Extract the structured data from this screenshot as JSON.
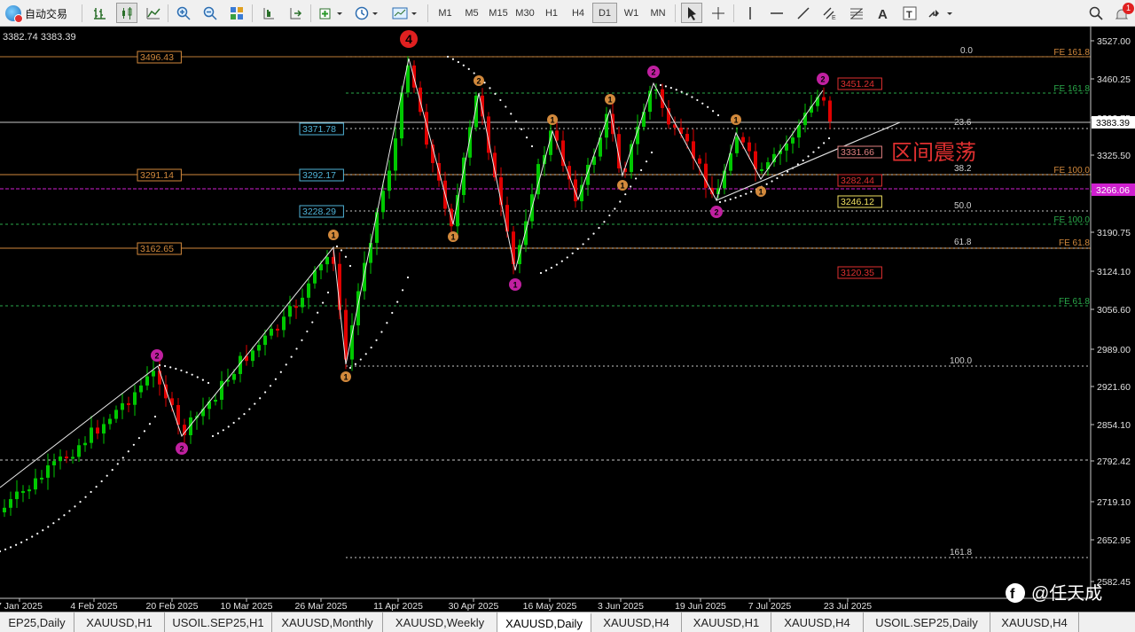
{
  "toolbar": {
    "autotrade_label": "自动交易",
    "timeframes": [
      "M1",
      "M5",
      "M15",
      "M30",
      "H1",
      "H4",
      "D1",
      "W1",
      "MN"
    ],
    "active_timeframe": "D1",
    "notification_count": "1"
  },
  "chart": {
    "quote": "3382.74 3383.39",
    "annotation": "区间震荡",
    "watermark": "@任天成",
    "current_price": "3383.39",
    "price_axis": [
      "3527.00",
      "3460.25",
      "3393.75",
      "3325.50",
      "3259.25",
      "3190.75",
      "3124.10",
      "3056.60",
      "2989.00",
      "2921.60",
      "2854.10",
      "2792.42",
      "2719.10",
      "2652.95",
      "2582.45"
    ],
    "date_axis": [
      "7 Jan 2025",
      "4 Feb 2025",
      "20 Feb 2025",
      "10 Mar 2025",
      "26 Mar 2025",
      "11 Apr 2025",
      "30 Apr 2025",
      "16 May 2025",
      "3 Jun 2025",
      "19 Jun 2025",
      "7 Jul 2025",
      "23 Jul 2025"
    ],
    "left_levels": [
      "3496.43",
      "3291.14",
      "3162.65"
    ],
    "mid_levels": [
      "3371.78",
      "3292.17",
      "3228.29"
    ],
    "right_levels": [
      "3451.24",
      "3331.66",
      "3282.44",
      "3246.12",
      "3120.35"
    ],
    "highlight_levels": [
      "3266.06"
    ],
    "fib_labels": [
      "0.0",
      "23.6",
      "38.2",
      "50.0",
      "61.8",
      "100.0",
      "161.8"
    ],
    "fe_labels": [
      "FE 161.8",
      "FE 161.8",
      "FE 100.0",
      "FE 100.0",
      "FE 61.8",
      "FE 61.8"
    ],
    "wave_labels": [
      "4",
      "2",
      "1",
      "2",
      "1",
      "1",
      "2",
      "1",
      "1",
      "1",
      "2",
      "1",
      "1",
      "2",
      "1",
      "2"
    ],
    "colors": {
      "up": "#00c800",
      "down": "#e00000",
      "level_orange": "#d2893c",
      "level_cyan": "#4fb3d8",
      "fe_green": "#2aa84a"
    }
  },
  "tabs": [
    "EP25,Daily",
    "XAUUSD,H1",
    "USOIL.SEP25,H1",
    "XAUUSD,Monthly",
    "XAUUSD,Weekly",
    "XAUUSD,Daily",
    "XAUUSD,H4",
    "XAUUSD,H1",
    "XAUUSD,H4",
    "USOIL.SEP25,Daily",
    "XAUUSD,H4"
  ],
  "active_tab": "XAUUSD,Daily"
}
